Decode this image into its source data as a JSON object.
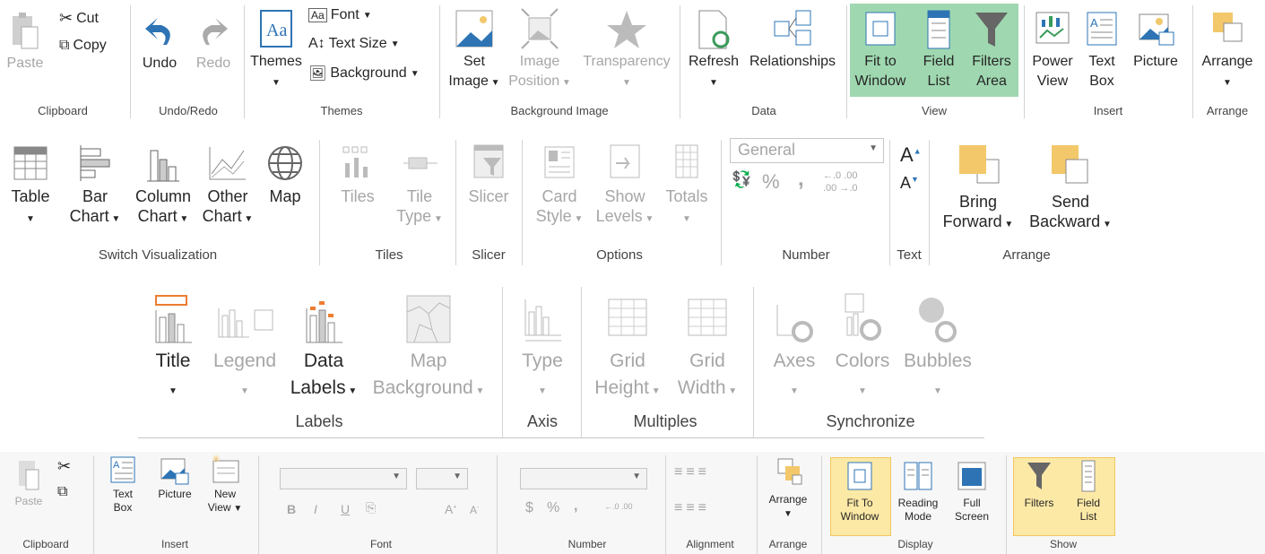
{
  "row1": {
    "clipboard": {
      "label": "Clipboard",
      "paste": "Paste",
      "cut": "Cut",
      "copy": "Copy"
    },
    "undo": {
      "label": "Undo/Redo",
      "undo": "Undo",
      "redo": "Redo"
    },
    "themes": {
      "label": "Themes",
      "themes": "Themes",
      "font": "Font",
      "text_size": "Text Size",
      "background": "Background"
    },
    "bgimage": {
      "label": "Background Image",
      "set1": "Set",
      "set2": "Image",
      "pos1": "Image",
      "pos2": "Position",
      "transparency": "Transparency"
    },
    "data": {
      "label": "Data",
      "refresh": "Refresh",
      "relationships": "Relationships"
    },
    "view": {
      "label": "View",
      "fit1": "Fit to",
      "fit2": "Window",
      "field1": "Field",
      "field2": "List",
      "filt1": "Filters",
      "filt2": "Area"
    },
    "insert": {
      "label": "Insert",
      "pv1": "Power",
      "pv2": "View",
      "tb1": "Text",
      "tb2": "Box",
      "picture": "Picture"
    },
    "arrange": {
      "label": "Arrange",
      "arrange": "Arrange"
    }
  },
  "row2": {
    "switchviz": {
      "label": "Switch Visualization",
      "table": "Table",
      "bar1": "Bar",
      "bar2": "Chart",
      "col1": "Column",
      "col2": "Chart",
      "oth1": "Other",
      "oth2": "Chart",
      "map": "Map"
    },
    "tiles": {
      "label": "Tiles",
      "tiles": "Tiles",
      "tt1": "Tile",
      "tt2": "Type"
    },
    "slicer": {
      "label": "Slicer",
      "slicer": "Slicer"
    },
    "options": {
      "label": "Options",
      "cs1": "Card",
      "cs2": "Style",
      "sl1": "Show",
      "sl2": "Levels",
      "totals": "Totals"
    },
    "number": {
      "label": "Number",
      "format": "General",
      "percent": "%",
      "comma": ",",
      "inc": "←.0 .00",
      "dec": ".00 →.0"
    },
    "text": {
      "label": "Text"
    },
    "arrange": {
      "label": "Arrange",
      "bf1": "Bring",
      "bf2": "Forward",
      "sb1": "Send",
      "sb2": "Backward"
    }
  },
  "row3": {
    "labels": {
      "label": "Labels",
      "title": "Title",
      "legend": "Legend",
      "dl1": "Data",
      "dl2": "Labels",
      "mb1": "Map",
      "mb2": "Background"
    },
    "axis": {
      "label": "Axis",
      "type": "Type"
    },
    "multiples": {
      "label": "Multiples",
      "gh1": "Grid",
      "gh2": "Height",
      "gw1": "Grid",
      "gw2": "Width"
    },
    "sync": {
      "label": "Synchronize",
      "axes": "Axes",
      "colors": "Colors",
      "bubbles": "Bubbles"
    }
  },
  "row4": {
    "clipboard": {
      "label": "Clipboard",
      "paste": "Paste"
    },
    "insert": {
      "label": "Insert",
      "tb1": "Text",
      "tb2": "Box",
      "picture": "Picture",
      "nv1": "New",
      "nv2": "View"
    },
    "font": {
      "label": "Font",
      "bold": "B",
      "italic": "I",
      "underline": "U"
    },
    "number": {
      "label": "Number",
      "dollar": "$",
      "percent": "%",
      "comma": ","
    },
    "alignment": {
      "label": "Alignment"
    },
    "arrange": {
      "label": "Arrange",
      "arrange": "Arrange"
    },
    "display": {
      "label": "Display",
      "fit1": "Fit To",
      "fit2": "Window",
      "rm1": "Reading",
      "rm2": "Mode",
      "fs1": "Full",
      "fs2": "Screen"
    },
    "show": {
      "label": "Show",
      "filters": "Filters",
      "fl1": "Field",
      "fl2": "List"
    }
  },
  "colors": {
    "view_highlight": "#9fd8b0",
    "show_highlight": "#fde9a6",
    "undo_blue": "#2e74b5",
    "refresh_green": "#3a9b5b",
    "arrange_gold": "#f3c86b"
  }
}
